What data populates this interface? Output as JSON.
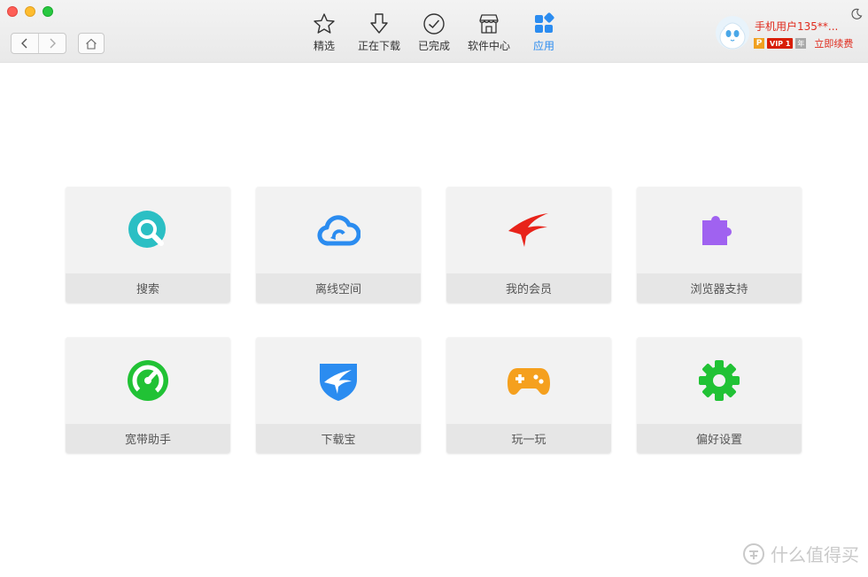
{
  "toolbar": {
    "tabs": [
      {
        "label": "精选",
        "icon": "star-icon"
      },
      {
        "label": "正在下载",
        "icon": "download-arrow-icon"
      },
      {
        "label": "已完成",
        "icon": "check-circle-icon"
      },
      {
        "label": "软件中心",
        "icon": "store-icon"
      },
      {
        "label": "应用",
        "icon": "apps-grid-icon",
        "active": true
      }
    ],
    "user": {
      "name": "手机用户135**...",
      "badge_p": "P",
      "badge_vip": "VIP 1",
      "badge_year": "年",
      "renew": "立即续费"
    }
  },
  "apps": [
    {
      "label": "搜索",
      "icon": "search-icon",
      "color": "#2bbfc4"
    },
    {
      "label": "离线空间",
      "icon": "cloud-icon",
      "color": "#2b8cf0"
    },
    {
      "label": "我的会员",
      "icon": "bird-logo-icon",
      "color": "#e8231a"
    },
    {
      "label": "浏览器支持",
      "icon": "puzzle-icon",
      "color": "#a062f0"
    },
    {
      "label": "宽带助手",
      "icon": "speedometer-icon",
      "color": "#21c235"
    },
    {
      "label": "下载宝",
      "icon": "shield-bird-icon",
      "color": "#2b8cf0"
    },
    {
      "label": "玩一玩",
      "icon": "gamepad-icon",
      "color": "#f5a01e"
    },
    {
      "label": "偏好设置",
      "icon": "gear-icon",
      "color": "#21c235"
    }
  ],
  "watermark": {
    "text": "什么值得买"
  }
}
